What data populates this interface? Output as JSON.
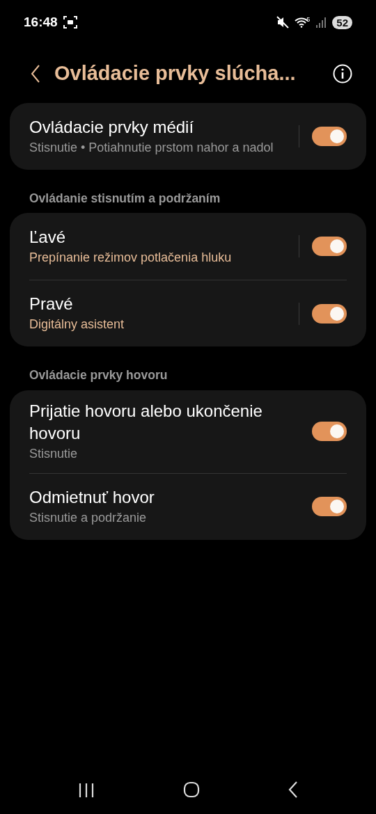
{
  "status_bar": {
    "time": "16:48",
    "wifi_badge": "5",
    "battery": "52"
  },
  "header": {
    "title": "Ovládacie prvky slúcha..."
  },
  "sections": [
    {
      "items": [
        {
          "title": "Ovládacie prvky médií",
          "subtitle": "Stisnutie • Potiahnutie prstom nahor a nadol",
          "subtitle_accent": false,
          "divider": true,
          "on": true
        }
      ]
    },
    {
      "heading": "Ovládanie stisnutím a podržaním",
      "items": [
        {
          "title": "Ľavé",
          "subtitle": "Prepínanie režimov potlačenia hluku",
          "subtitle_accent": true,
          "divider": true,
          "on": true
        },
        {
          "title": "Pravé",
          "subtitle": "Digitálny asistent",
          "subtitle_accent": true,
          "divider": true,
          "on": true
        }
      ]
    },
    {
      "heading": "Ovládacie prvky hovoru",
      "items": [
        {
          "title": "Prijatie hovoru alebo ukončenie hovoru",
          "subtitle": "Stisnutie",
          "subtitle_accent": false,
          "divider": false,
          "on": true
        },
        {
          "title": "Odmietnuť hovor",
          "subtitle": "Stisnutie a podržanie",
          "subtitle_accent": false,
          "divider": false,
          "on": true
        }
      ]
    }
  ]
}
